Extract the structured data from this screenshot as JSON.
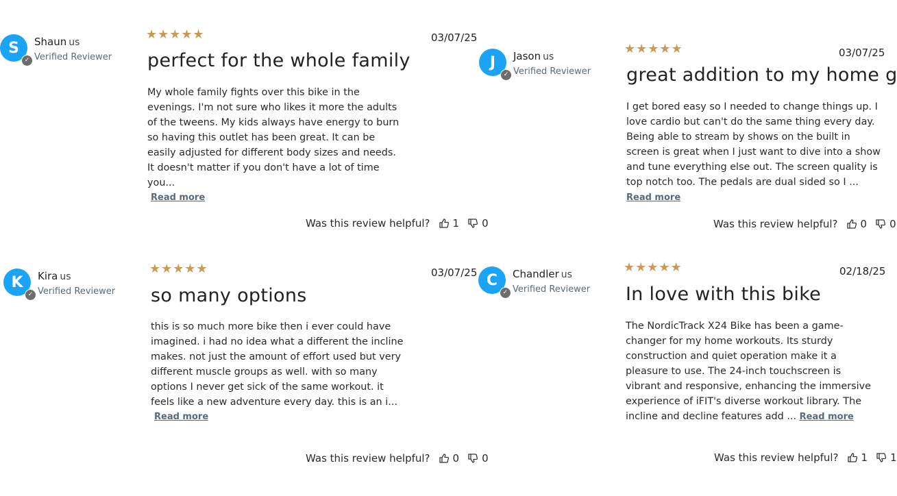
{
  "helpful_label": "Was this review helpful?",
  "read_more_label": "Read more",
  "star_glyphs": "★★★★★",
  "reviews": [
    {
      "initial": "S",
      "name": "Shaun",
      "location": "us",
      "verified": "Verified Reviewer",
      "rating": 5,
      "date": "03/07/25",
      "title": "perfect for the whole family",
      "body": "My whole family fights over this bike in the evenings. I'm not sure who likes it more the adults of the tweens. My kids always have energy to burn so having this outlet has been great. It can be easily adjusted for different body sizes and needs. It doesn't matter if you don't have a lot of time you...",
      "up": "1",
      "down": "0"
    },
    {
      "initial": "J",
      "name": "Jason",
      "location": "us",
      "verified": "Verified Reviewer",
      "rating": 5,
      "date": "03/07/25",
      "title": "great addition to my home gym",
      "body": "I get bored easy so I needed to change things up. I love cardio but can't do the same thing every day. Being able to stream by shows on the built in screen is great when I just want to dive into a show and tune everything else out. The screen quality is top notch too. The pedals are dual sided so I ...",
      "up": "0",
      "down": "0"
    },
    {
      "initial": "K",
      "name": "Kira",
      "location": "us",
      "verified": "Verified Reviewer",
      "rating": 5,
      "date": "03/07/25",
      "title": "so many options",
      "body": "this is so much more bike then i ever could have imagined. i had no idea what a different the incline makes. not just the amount of effort used but very different muscle groups as well. with so many options I never get sick of the same workout. it feels like a new adventure every day. this is an i...",
      "up": "0",
      "down": "0"
    },
    {
      "initial": "C",
      "name": "Chandler",
      "location": "us",
      "verified": "Verified Reviewer",
      "rating": 5,
      "date": "02/18/25",
      "title": "In love with this bike",
      "body": "The NordicTrack X24 Bike has been a game-changer for my home workouts. Its sturdy construction and quiet operation make it a pleasure to use. The 24-inch touchscreen is vibrant and responsive, enhancing the immersive experience of iFIT's diverse workout library. The incline and decline features add ...",
      "up": "1",
      "down": "1"
    }
  ]
}
